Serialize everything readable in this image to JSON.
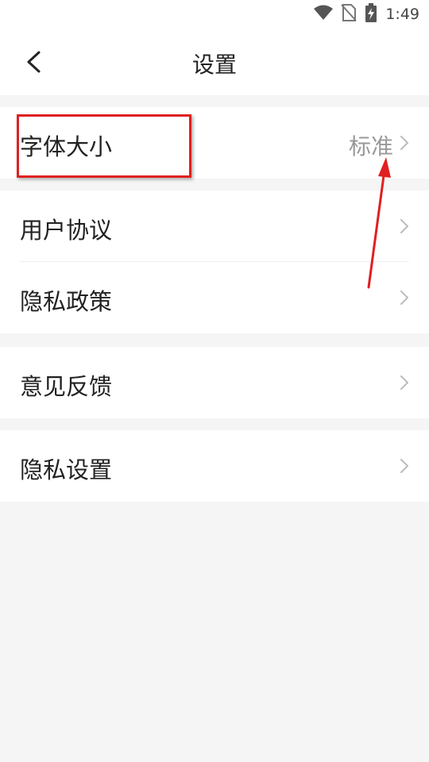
{
  "status_bar": {
    "time": "1:49",
    "icons": [
      "wifi-icon",
      "no-sim-icon",
      "battery-charging-icon"
    ]
  },
  "nav": {
    "back_icon": "chevron-left-icon",
    "title": "设置"
  },
  "settings": {
    "font_size": {
      "label": "字体大小",
      "value": "标准"
    },
    "user_agreement": {
      "label": "用户协议"
    },
    "privacy_policy": {
      "label": "隐私政策"
    },
    "feedback": {
      "label": "意见反馈"
    },
    "privacy_settings": {
      "label": "隐私设置"
    }
  },
  "annotations": {
    "highlight_color": "#e02020",
    "arrow_color": "#e02020"
  }
}
